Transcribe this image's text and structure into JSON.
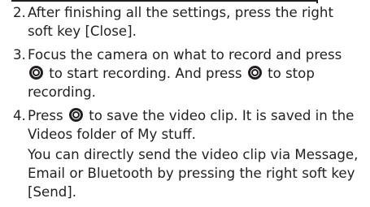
{
  "steps": [
    {
      "number": "2.",
      "text": "After finishing all the settings, press the right soft key [Close]."
    },
    {
      "number": "3.",
      "text_a": "Focus the camera on what to record and press",
      "text_b": "to start recording. And press",
      "text_c": "to stop recording."
    },
    {
      "number": "4.",
      "text_a": "Press",
      "text_b": "to save the video clip. It is saved in the Videos folder of My stuff."
    }
  ],
  "note": "You can directly send the video clip via Message, Email or Bluetooth by pressing the right soft key [Send].",
  "icons": {
    "ok_key": "center-navigation-key-icon"
  },
  "colors": {
    "text": "#231f20",
    "background": "#ffffff"
  }
}
